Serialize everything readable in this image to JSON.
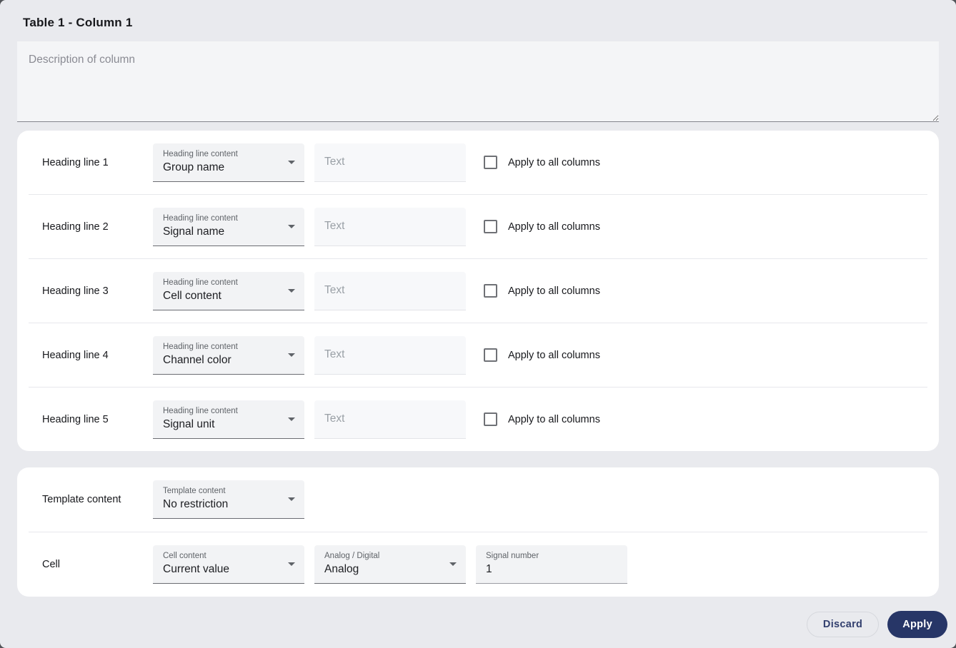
{
  "window": {
    "title": "Table 1 - Column 1"
  },
  "description": {
    "placeholder": "Description of column",
    "value": ""
  },
  "heading_rows": [
    {
      "label": "Heading line 1",
      "select_label": "Heading line content",
      "select_value": "Group name",
      "text_placeholder": "Text",
      "checkbox_label": "Apply to all columns",
      "checked": false
    },
    {
      "label": "Heading line 2",
      "select_label": "Heading line content",
      "select_value": "Signal name",
      "text_placeholder": "Text",
      "checkbox_label": "Apply to all columns",
      "checked": false
    },
    {
      "label": "Heading line 3",
      "select_label": "Heading line content",
      "select_value": "Cell content",
      "text_placeholder": "Text",
      "checkbox_label": "Apply to all columns",
      "checked": false
    },
    {
      "label": "Heading line 4",
      "select_label": "Heading line content",
      "select_value": "Channel color",
      "text_placeholder": "Text",
      "checkbox_label": "Apply to all columns",
      "checked": false
    },
    {
      "label": "Heading line 5",
      "select_label": "Heading line content",
      "select_value": "Signal unit",
      "text_placeholder": "Text",
      "checkbox_label": "Apply to all columns",
      "checked": false
    }
  ],
  "template_section": {
    "template_row": {
      "label": "Template content",
      "select_label": "Template content",
      "select_value": "No restriction"
    },
    "cell_row": {
      "label": "Cell",
      "content_select": {
        "label": "Cell content",
        "value": "Current value"
      },
      "analog_select": {
        "label": "Analog / Digital",
        "value": "Analog"
      },
      "signal_number": {
        "label": "Signal number",
        "value": "1"
      }
    }
  },
  "footer": {
    "discard_label": "Discard",
    "apply_label": "Apply"
  },
  "colors": {
    "accent": "#273667",
    "page_background": "#e9eaee",
    "card_background": "#ffffff",
    "field_background": "#f2f3f5"
  }
}
